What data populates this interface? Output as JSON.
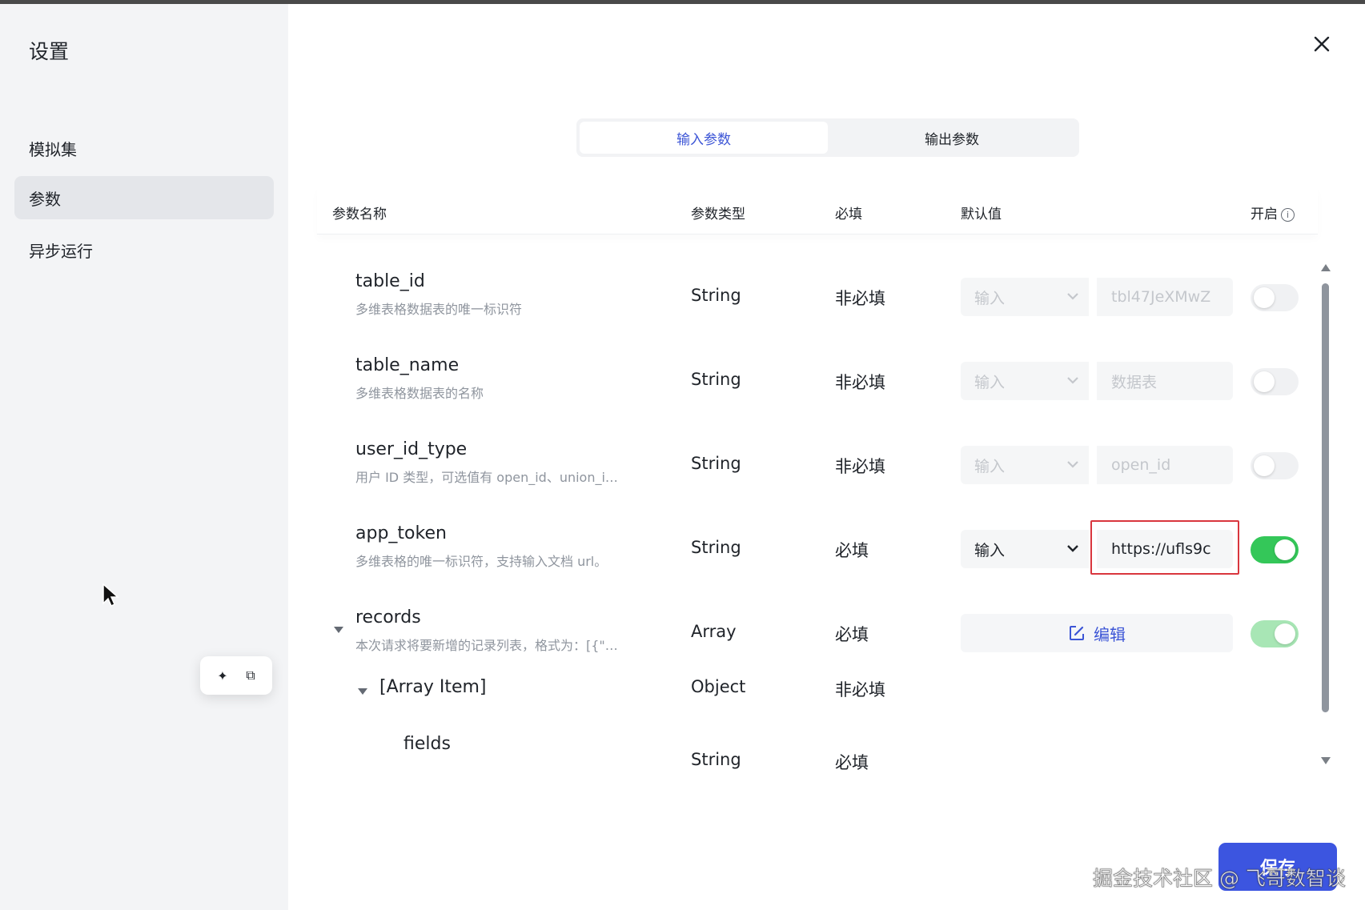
{
  "sidebar": {
    "title": "设置",
    "items": [
      {
        "label": "模拟集"
      },
      {
        "label": "参数"
      },
      {
        "label": "异步运行"
      }
    ]
  },
  "tabs": [
    {
      "label": "输入参数"
    },
    {
      "label": "输出参数"
    }
  ],
  "table": {
    "headers": {
      "name": "参数名称",
      "type": "参数类型",
      "required": "必填",
      "default": "默认值",
      "enabled": "开启"
    },
    "rows": [
      {
        "name": "table_id",
        "desc": "多维表格数据表的唯一标识符",
        "type": "String",
        "required": "非必填",
        "mode": "输入",
        "value": "tbl47JeXMwZ",
        "enabled": false
      },
      {
        "name": "table_name",
        "desc": "多维表格数据表的名称",
        "type": "String",
        "required": "非必填",
        "mode": "输入",
        "value": "数据表",
        "enabled": false
      },
      {
        "name": "user_id_type",
        "desc": "用户 ID 类型，可选值有 open_id、union_i…",
        "type": "String",
        "required": "非必填",
        "mode": "输入",
        "value": "open_id",
        "enabled": false
      },
      {
        "name": "app_token",
        "desc": "多维表格的唯一标识符，支持输入文档 url。",
        "type": "String",
        "required": "必填",
        "mode": "输入",
        "value": "https://ufls9c",
        "enabled": true
      },
      {
        "name": "records",
        "desc": "本次请求将要新增的记录列表，格式为：[{\"…",
        "type": "Array",
        "required": "必填",
        "edit_label": "编辑",
        "enabled": true
      },
      {
        "name": "[Array Item]",
        "type": "Object",
        "required": "非必填"
      },
      {
        "name": "fields",
        "type": "String",
        "required": "必填"
      }
    ]
  },
  "footer": {
    "save_label": "保存",
    "watermark": "掘金技术社区 @ 飞哥数智谈"
  },
  "colors": {
    "accent": "#3c55d6",
    "toggle_on": "#34c759",
    "highlight": "#d9363e"
  }
}
